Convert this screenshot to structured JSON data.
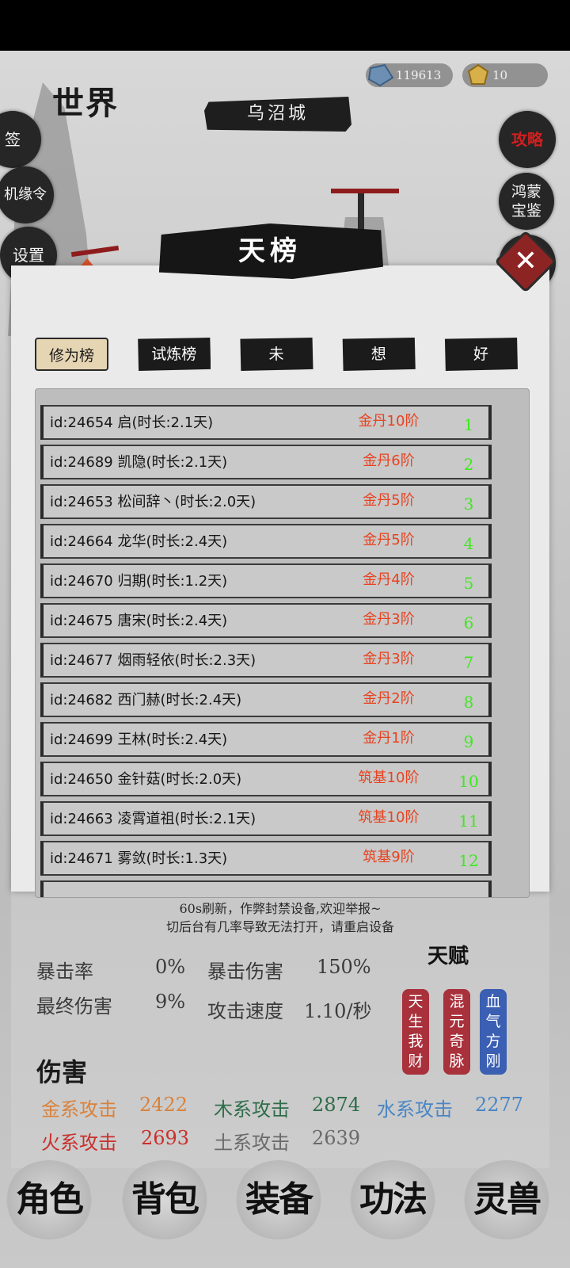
{
  "currency": {
    "jade": "119613",
    "gold": "10"
  },
  "world": {
    "title": "世界",
    "city": "乌沼城"
  },
  "left_menu": [
    "签",
    "机缘令",
    "设置"
  ],
  "right_menu": [
    "攻略",
    "鸿蒙宝鉴",
    "天榜"
  ],
  "modal": {
    "title": "天榜",
    "tabs": [
      "修为榜",
      "试炼榜",
      "未",
      "想",
      "好"
    ],
    "active_tab": 0,
    "rows": [
      {
        "name": "id:24654 启(时长:2.1天)",
        "rank": "金丹10阶",
        "pos": "1"
      },
      {
        "name": "id:24689 凯隐(时长:2.1天)",
        "rank": "金丹6阶",
        "pos": "2"
      },
      {
        "name": "id:24653 松间辞丶(时长:2.0天)",
        "rank": "金丹5阶",
        "pos": "3"
      },
      {
        "name": "id:24664 龙华(时长:2.4天)",
        "rank": "金丹5阶",
        "pos": "4"
      },
      {
        "name": "id:24670 归期(时长:1.2天)",
        "rank": "金丹4阶",
        "pos": "5"
      },
      {
        "name": "id:24675 唐宋(时长:2.4天)",
        "rank": "金丹3阶",
        "pos": "6"
      },
      {
        "name": "id:24677 烟雨轻依(时长:2.3天)",
        "rank": "金丹3阶",
        "pos": "7"
      },
      {
        "name": "id:24682 西门赫(时长:2.4天)",
        "rank": "金丹2阶",
        "pos": "8"
      },
      {
        "name": "id:24699 王林(时长:2.4天)",
        "rank": "金丹1阶",
        "pos": "9"
      },
      {
        "name": "id:24650 金针菇(时长:2.0天)",
        "rank": "筑基10阶",
        "pos": "10"
      },
      {
        "name": "id:24663 凌霄道祖(时长:2.1天)",
        "rank": "筑基10阶",
        "pos": "11"
      },
      {
        "name": "id:24671 雾敛(时长:1.3天)",
        "rank": "筑基9阶",
        "pos": "12"
      }
    ],
    "footnote_1": "60s刷新，作弊封禁设备,欢迎举报~",
    "footnote_2": "切后台有几率导致无法打开，请重启设备"
  },
  "stats": {
    "crit_rate_label": "暴击率",
    "crit_rate": "0%",
    "crit_dmg_label": "暴击伤害",
    "crit_dmg": "150%",
    "final_dmg_label": "最终伤害",
    "final_dmg": "9%",
    "atk_speed_label": "攻击速度",
    "atk_speed": "1.10/秒",
    "talent_title": "天赋",
    "talents": [
      "天生我财",
      "混元奇脉",
      "血气方刚"
    ],
    "damage_title": "伤害",
    "metal_label": "金系攻击",
    "metal": "2422",
    "wood_label": "木系攻击",
    "wood": "2874",
    "water_label": "水系攻击",
    "water": "2277",
    "fire_label": "火系攻击",
    "fire": "2693",
    "earth_label": "土系攻击",
    "earth": "2639"
  },
  "nav": [
    "角色",
    "背包",
    "装备",
    "功法",
    "灵兽"
  ],
  "colors": {
    "rank_red": "#e8421f",
    "pos_green": "#3ee81e",
    "metal": "#d9823c",
    "wood": "#2f6d4a",
    "water": "#4a86c4",
    "fire": "#c9302c",
    "earth": "#6a6a6a"
  }
}
